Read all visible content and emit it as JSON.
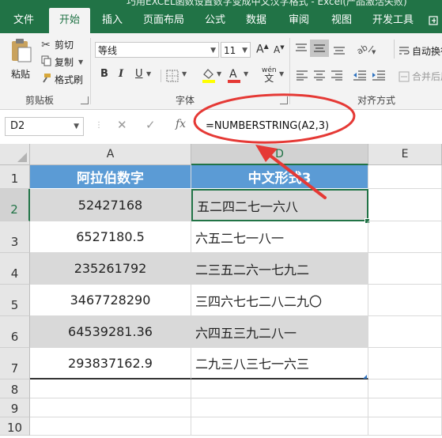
{
  "title": "巧用EXCEL函数设置数字变成中文汉字格式 - Excel(产品激活失败)",
  "tabs": [
    "文件",
    "开始",
    "插入",
    "页面布局",
    "公式",
    "数据",
    "审阅",
    "视图",
    "开发工具"
  ],
  "active_tab": "开始",
  "clipboard": {
    "paste": "粘贴",
    "cut": "剪切",
    "copy": "复制",
    "format_painter": "格式刷",
    "group_label": "剪贴板"
  },
  "font": {
    "name": "等线",
    "size": "11",
    "grow": "A",
    "shrink": "A",
    "bold": "B",
    "italic": "I",
    "underline": "U",
    "phonetic": "wén",
    "group_label": "字体"
  },
  "alignment": {
    "wrap_text": "自动换行",
    "merge": "合并后居中",
    "group_label": "对齐方式"
  },
  "formula_bar": {
    "name_box": "D2",
    "cancel": "✕",
    "enter": "✓",
    "fx": "fx",
    "formula": "=NUMBERSTRING(A2,3)"
  },
  "columns": [
    {
      "label": "A",
      "selected": false
    },
    {
      "label": "D",
      "selected": true
    },
    {
      "label": "E",
      "selected": false
    }
  ],
  "rows": [
    {
      "num": "1",
      "a": "阿拉伯数字",
      "d": "中文形式3",
      "header": true
    },
    {
      "num": "2",
      "a": "52427168",
      "d": "五二四二七一六八",
      "band": true,
      "active": true
    },
    {
      "num": "3",
      "a": "6527180.5",
      "d": "六五二七一八一",
      "band": false
    },
    {
      "num": "4",
      "a": "235261792",
      "d": "二三五二六一七九二",
      "band": true
    },
    {
      "num": "5",
      "a": "3467728290",
      "d": "三四六七七二八二九〇",
      "band": false
    },
    {
      "num": "6",
      "a": "64539281.36",
      "d": "六四五三九二八一",
      "band": true
    },
    {
      "num": "7",
      "a": "293837162.9",
      "d": "二九三八三七一六三",
      "band": false
    },
    {
      "num": "8"
    },
    {
      "num": "9"
    },
    {
      "num": "10"
    }
  ],
  "colors": {
    "excel_green": "#217346",
    "header_blue": "#5b9bd5",
    "band_gray": "#d9d9d9",
    "annotation_red": "#e53935"
  }
}
